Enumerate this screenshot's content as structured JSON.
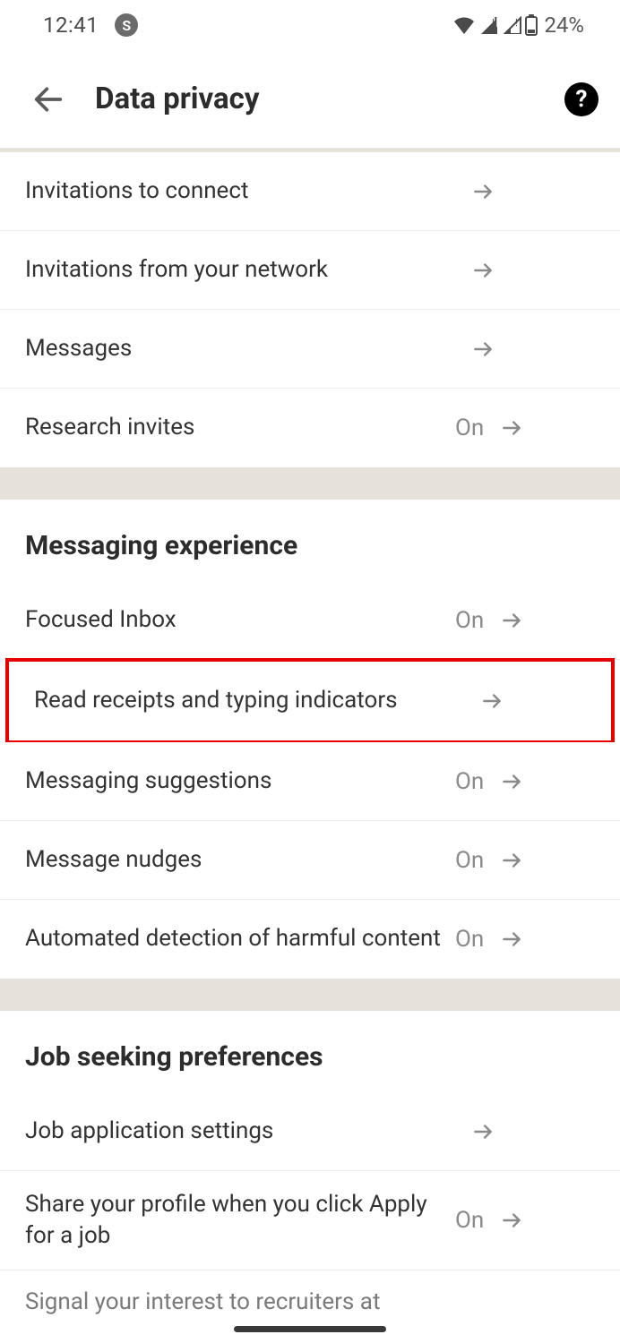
{
  "status": {
    "time": "12:41",
    "battery": "24%"
  },
  "header": {
    "title": "Data privacy"
  },
  "groups": [
    {
      "items": [
        {
          "label": "Invitations to connect",
          "value": ""
        },
        {
          "label": "Invitations from your network",
          "value": ""
        },
        {
          "label": "Messages",
          "value": ""
        },
        {
          "label": "Research invites",
          "value": "On"
        }
      ]
    },
    {
      "title": "Messaging experience",
      "items": [
        {
          "label": "Focused Inbox",
          "value": "On"
        },
        {
          "label": "Read receipts and typing indicators",
          "value": "",
          "highlight": true
        },
        {
          "label": "Messaging suggestions",
          "value": "On"
        },
        {
          "label": "Message nudges",
          "value": "On"
        },
        {
          "label": "Automated detection of harmful content",
          "value": "On"
        }
      ]
    },
    {
      "title": "Job seeking preferences",
      "items": [
        {
          "label": "Job application settings",
          "value": ""
        },
        {
          "label": "Share your profile when you click Apply for a job",
          "value": "On"
        }
      ],
      "cutoff": "Signal your interest to recruiters at"
    }
  ]
}
